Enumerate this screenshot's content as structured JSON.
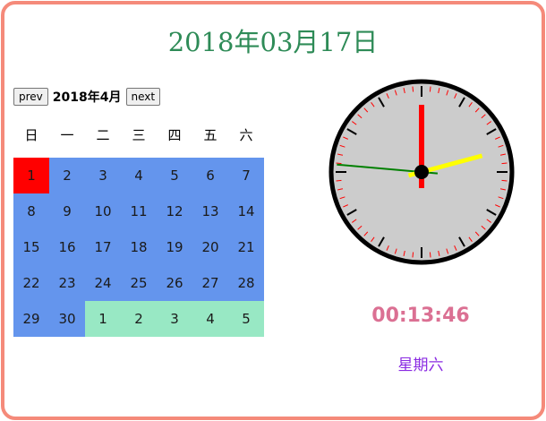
{
  "header": {
    "date_title": "2018年03月17日"
  },
  "calendar": {
    "prev_label": "prev",
    "next_label": "next",
    "month_label": "2018年4月",
    "weekdays": [
      "日",
      "一",
      "二",
      "三",
      "四",
      "五",
      "六"
    ],
    "days": [
      {
        "label": "1",
        "state": "today"
      },
      {
        "label": "2",
        "state": "current"
      },
      {
        "label": "3",
        "state": "current"
      },
      {
        "label": "4",
        "state": "current"
      },
      {
        "label": "5",
        "state": "current"
      },
      {
        "label": "6",
        "state": "current"
      },
      {
        "label": "7",
        "state": "current"
      },
      {
        "label": "8",
        "state": "current"
      },
      {
        "label": "9",
        "state": "current"
      },
      {
        "label": "10",
        "state": "current"
      },
      {
        "label": "11",
        "state": "current"
      },
      {
        "label": "12",
        "state": "current"
      },
      {
        "label": "13",
        "state": "current"
      },
      {
        "label": "14",
        "state": "current"
      },
      {
        "label": "15",
        "state": "current"
      },
      {
        "label": "16",
        "state": "current"
      },
      {
        "label": "17",
        "state": "current"
      },
      {
        "label": "18",
        "state": "current"
      },
      {
        "label": "19",
        "state": "current"
      },
      {
        "label": "20",
        "state": "current"
      },
      {
        "label": "21",
        "state": "current"
      },
      {
        "label": "22",
        "state": "current"
      },
      {
        "label": "23",
        "state": "current"
      },
      {
        "label": "24",
        "state": "current"
      },
      {
        "label": "25",
        "state": "current"
      },
      {
        "label": "26",
        "state": "current"
      },
      {
        "label": "27",
        "state": "current"
      },
      {
        "label": "28",
        "state": "current"
      },
      {
        "label": "29",
        "state": "current"
      },
      {
        "label": "30",
        "state": "current"
      },
      {
        "label": "1",
        "state": "next"
      },
      {
        "label": "2",
        "state": "next"
      },
      {
        "label": "3",
        "state": "next"
      },
      {
        "label": "4",
        "state": "next"
      },
      {
        "label": "5",
        "state": "next"
      }
    ]
  },
  "clock": {
    "hour": 0,
    "minute": 13,
    "second": 46,
    "hand_colors": {
      "hour": "#ffff00",
      "minute": "#008000",
      "second": "#ff0000"
    },
    "face_color": "#cccccc"
  },
  "status": {
    "time_text": "00:13:46",
    "weekday_text": "星期六"
  },
  "colors": {
    "frame": "#f58a7a",
    "title": "#2e8b57",
    "current_day": "#6495ed",
    "today": "#ff0000",
    "next_month_day": "#98e8c4",
    "time": "#db7093",
    "weekday": "#8a2be2"
  }
}
